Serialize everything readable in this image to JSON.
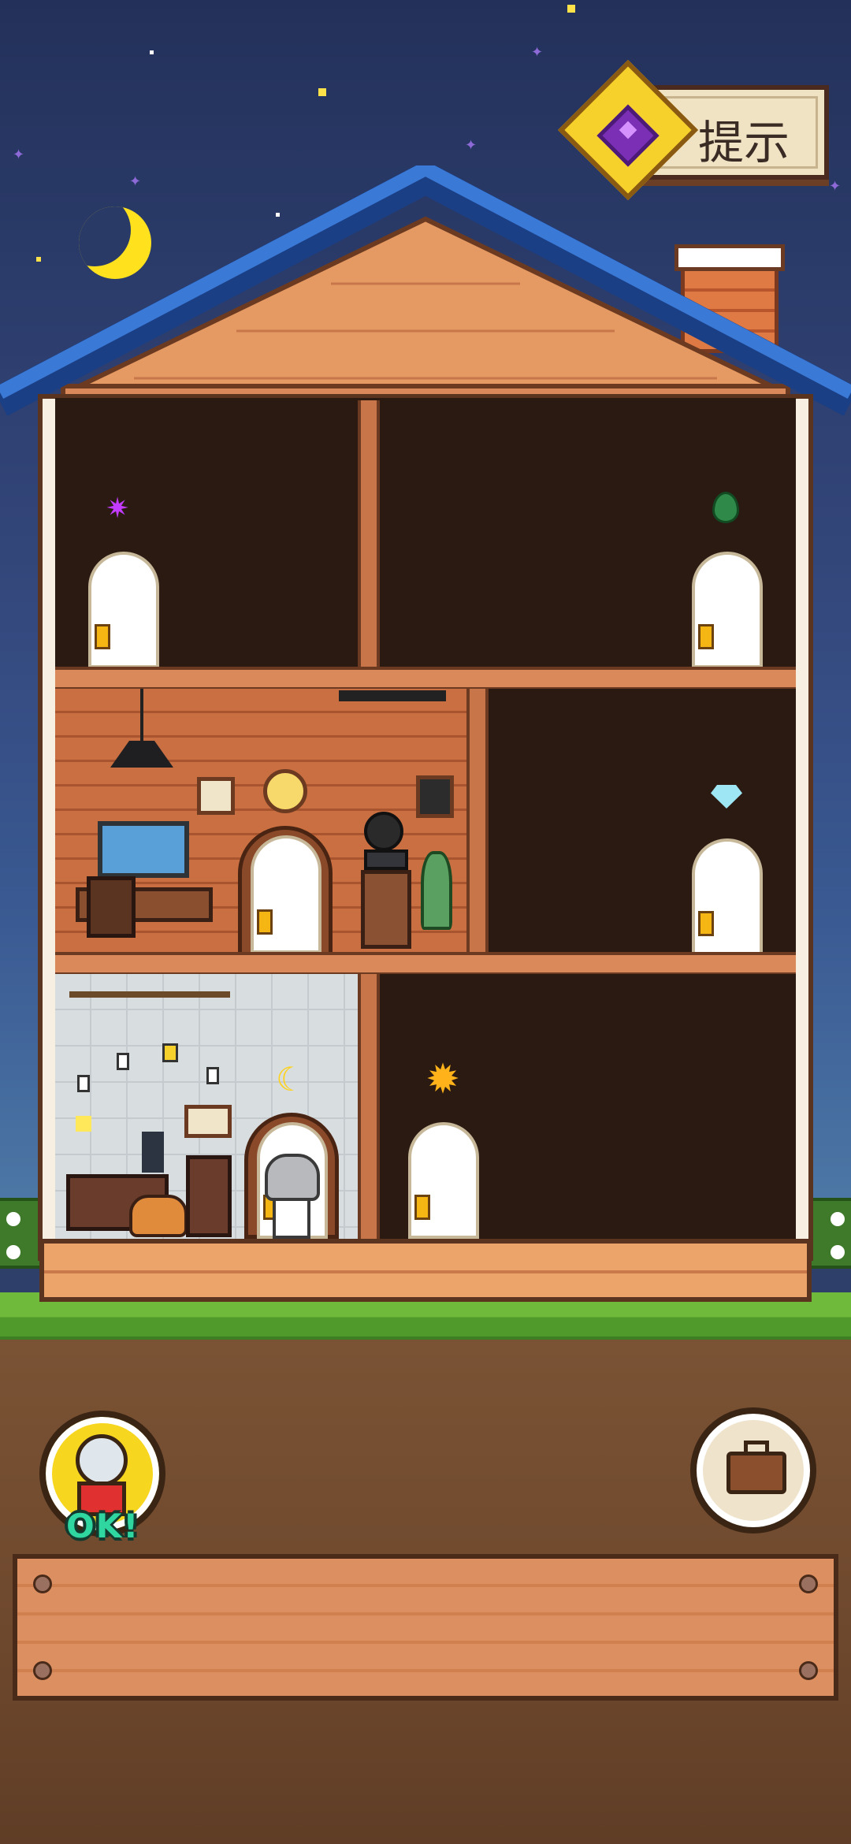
{
  "hint_button": {
    "label": "提示",
    "icon": "gem-book-icon"
  },
  "gacha_button": {
    "icon": "gachapon-machine-icon",
    "status_text": "OK!"
  },
  "inventory_button": {
    "icon": "briefcase-icon"
  },
  "message_panel": {
    "text": ""
  },
  "scene": {
    "title": "",
    "floors": [
      {
        "rooms": [
          {
            "name": "attic-left",
            "lit": false,
            "symbol": "purple-sparkle-icon"
          },
          {
            "name": "attic-right",
            "lit": false,
            "symbol": "green-leaf-icon"
          }
        ]
      },
      {
        "rooms": [
          {
            "name": "study",
            "lit": true
          },
          {
            "name": "middle-right",
            "lit": false,
            "symbol": "diamond-icon"
          }
        ]
      },
      {
        "rooms": [
          {
            "name": "bedroom",
            "lit": true,
            "symbol": "moon-icon"
          },
          {
            "name": "ground-right",
            "lit": false,
            "symbol": "sun-icon"
          }
        ]
      }
    ]
  },
  "colors": {
    "roof": "#2a5fb8",
    "sky": "#2e3f6a",
    "gacha_ok": "#2fd6a0"
  }
}
